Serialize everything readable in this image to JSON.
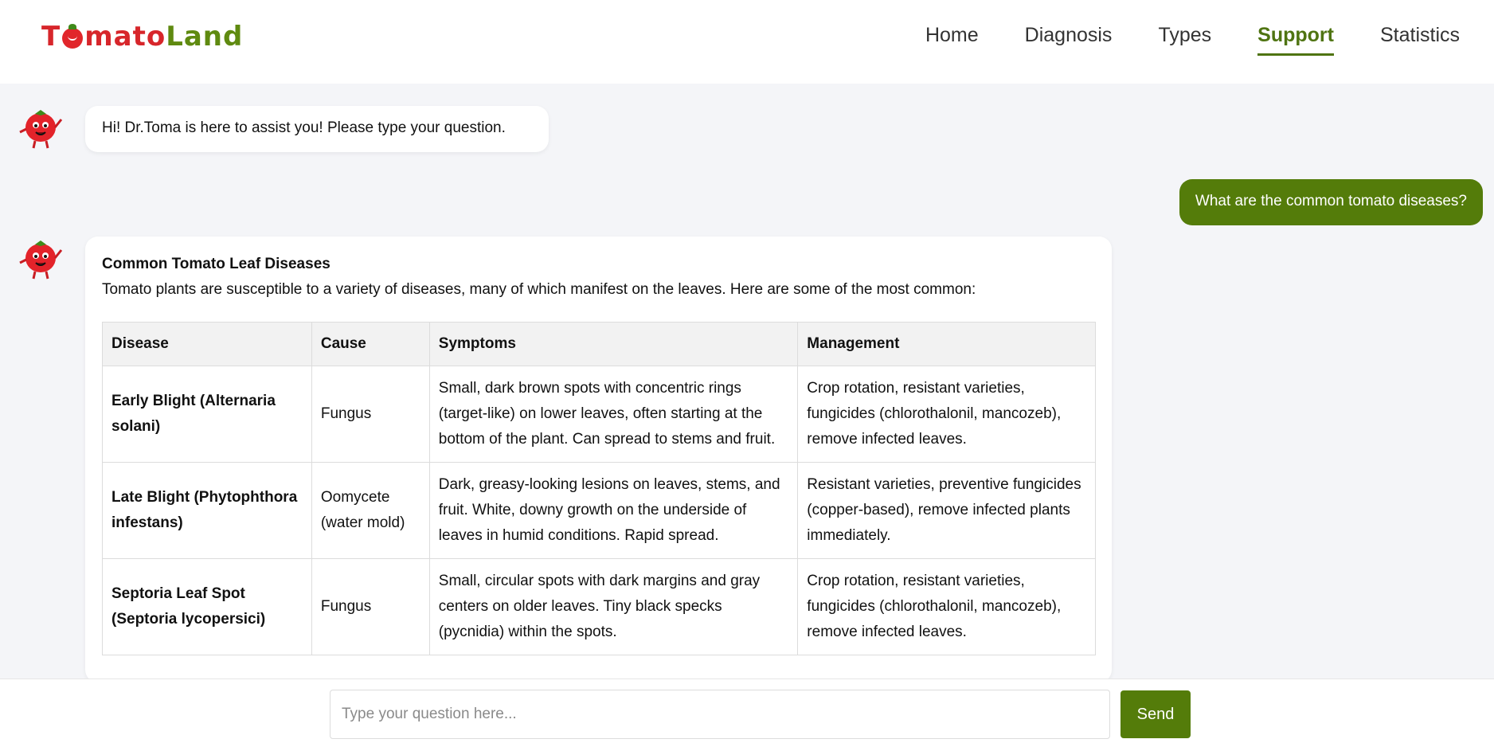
{
  "header": {
    "logo": {
      "part1": "T",
      "part2": "mato",
      "part3": "Land"
    },
    "nav": [
      {
        "label": "Home",
        "active": false
      },
      {
        "label": "Diagnosis",
        "active": false
      },
      {
        "label": "Types",
        "active": false
      },
      {
        "label": "Support",
        "active": true
      },
      {
        "label": "Statistics",
        "active": false
      }
    ]
  },
  "chat": {
    "greeting": "Hi! Dr.Toma is here to assist you! Please type your question.",
    "user_question": "What are the common tomato diseases?",
    "answer": {
      "title": "Common Tomato Leaf Diseases",
      "intro": "Tomato plants are susceptible to a variety of diseases, many of which manifest on the leaves. Here are some of the most common:",
      "table": {
        "headers": [
          "Disease",
          "Cause",
          "Symptoms",
          "Management"
        ],
        "rows": [
          [
            "Early Blight (Alternaria solani)",
            "Fungus",
            "Small, dark brown spots with concentric rings (target-like) on lower leaves, often starting at the bottom of the plant. Can spread to stems and fruit.",
            "Crop rotation, resistant varieties, fungicides (chlorothalonil, mancozeb), remove infected leaves."
          ],
          [
            "Late Blight (Phytophthora infestans)",
            "Oomycete (water mold)",
            "Dark, greasy-looking lesions on leaves, stems, and fruit. White, downy growth on the underside of leaves in humid conditions. Rapid spread.",
            "Resistant varieties, preventive fungicides (copper-based), remove infected plants immediately."
          ],
          [
            "Septoria Leaf Spot (Septoria lycopersici)",
            "Fungus",
            "Small, circular spots with dark margins and gray centers on older leaves. Tiny black specks (pycnidia) within the spots.",
            "Crop rotation, resistant varieties, fungicides (chlorothalonil, mancozeb), remove infected leaves."
          ]
        ]
      }
    }
  },
  "input": {
    "placeholder": "Type your question here...",
    "value": "",
    "send_label": "Send"
  },
  "colors": {
    "brand_red": "#d7262b",
    "brand_green": "#547c0a",
    "background": "#f4f5f8"
  }
}
